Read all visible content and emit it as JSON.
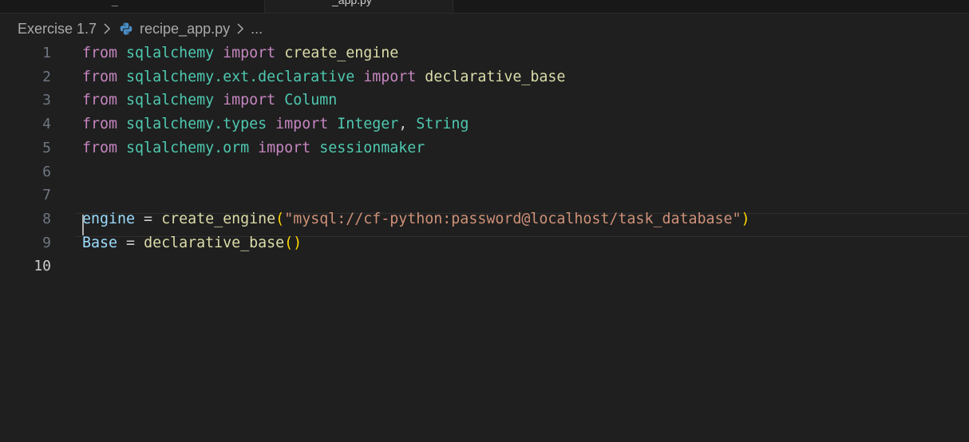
{
  "tabs": [
    {
      "label": "_",
      "active": false
    },
    {
      "label": "_app.py",
      "active": true
    }
  ],
  "breadcrumb": {
    "folder": "Exercise 1.7",
    "file": "recipe_app.py",
    "more": "..."
  },
  "editor": {
    "current_line": 10,
    "lines": [
      {
        "number": "1",
        "tokens": [
          [
            "kw",
            "from"
          ],
          [
            "op",
            " "
          ],
          [
            "mod",
            "sqlalchemy"
          ],
          [
            "op",
            " "
          ],
          [
            "kw",
            "import"
          ],
          [
            "op",
            " "
          ],
          [
            "fn",
            "create_engine"
          ]
        ]
      },
      {
        "number": "2",
        "tokens": [
          [
            "kw",
            "from"
          ],
          [
            "op",
            " "
          ],
          [
            "mod",
            "sqlalchemy.ext.declarative"
          ],
          [
            "op",
            " "
          ],
          [
            "kw",
            "import"
          ],
          [
            "op",
            " "
          ],
          [
            "fn",
            "declarative_base"
          ]
        ]
      },
      {
        "number": "3",
        "tokens": [
          [
            "kw",
            "from"
          ],
          [
            "op",
            " "
          ],
          [
            "mod",
            "sqlalchemy"
          ],
          [
            "op",
            " "
          ],
          [
            "kw",
            "import"
          ],
          [
            "op",
            " "
          ],
          [
            "cls",
            "Column"
          ]
        ]
      },
      {
        "number": "4",
        "tokens": [
          [
            "kw",
            "from"
          ],
          [
            "op",
            " "
          ],
          [
            "mod",
            "sqlalchemy.types"
          ],
          [
            "op",
            " "
          ],
          [
            "kw",
            "import"
          ],
          [
            "op",
            " "
          ],
          [
            "cls",
            "Integer"
          ],
          [
            "op",
            ", "
          ],
          [
            "cls",
            "String"
          ]
        ]
      },
      {
        "number": "5",
        "tokens": [
          [
            "kw",
            "from"
          ],
          [
            "op",
            " "
          ],
          [
            "mod",
            "sqlalchemy.orm"
          ],
          [
            "op",
            " "
          ],
          [
            "kw",
            "import"
          ],
          [
            "op",
            " "
          ],
          [
            "cls",
            "sessionmaker"
          ]
        ]
      },
      {
        "number": "6",
        "tokens": []
      },
      {
        "number": "7",
        "tokens": []
      },
      {
        "number": "8",
        "tokens": [
          [
            "var",
            "engine"
          ],
          [
            "op",
            " = "
          ],
          [
            "fn",
            "create_engine"
          ],
          [
            "br",
            "("
          ],
          [
            "str",
            "\"mysql://cf-python:password@localhost/task_database\""
          ],
          [
            "br",
            ")"
          ]
        ]
      },
      {
        "number": "9",
        "tokens": [
          [
            "var",
            "Base"
          ],
          [
            "op",
            " = "
          ],
          [
            "fn",
            "declarative_base"
          ],
          [
            "br",
            "()"
          ]
        ]
      },
      {
        "number": "10",
        "tokens": []
      }
    ]
  },
  "icons": {
    "breadcrumb_separator": "chevron-right-icon",
    "file_type": "python-icon"
  },
  "colors": {
    "keyword": "#c586c0",
    "module": "#4ec9b0",
    "function": "#dcdcaa",
    "variable": "#9cdcfe",
    "string": "#ce9178",
    "bracket": "#ffd700",
    "background": "#1f1f1f"
  }
}
